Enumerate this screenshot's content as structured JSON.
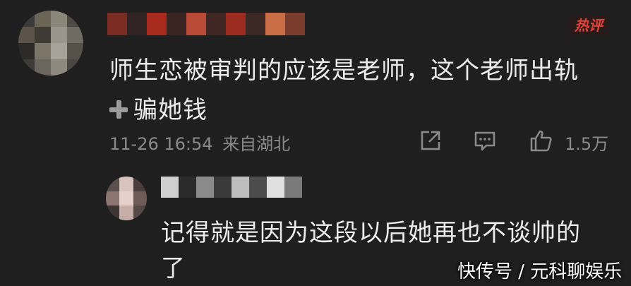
{
  "comment": {
    "hot_badge": "热评",
    "text_line1": "师生恋被审判的应该是老师，这个老师出轨",
    "text_line2": "骗她钱",
    "timestamp": "11-26 16:54",
    "location": "来自湖北",
    "like_count": "1.5万"
  },
  "reply": {
    "text": "记得就是因为这段以后她再也不谈帅的了"
  },
  "watermark": "快传号 / 元科聊娱乐",
  "colors": {
    "background": "#1f1f1f",
    "text": "#ececec",
    "meta": "#8a8a8a",
    "hot": "#e0443a"
  },
  "icons": {
    "share": "share-icon",
    "reply": "comment-icon",
    "like": "thumbs-up-icon",
    "plus": "plus-icon"
  }
}
